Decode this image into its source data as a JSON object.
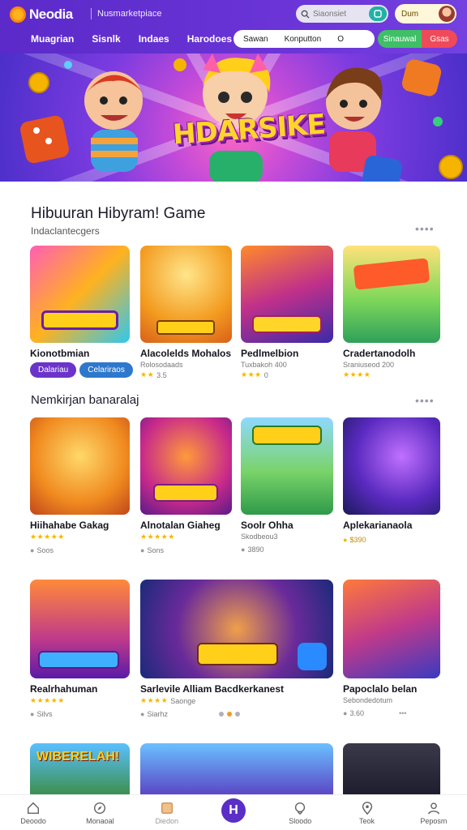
{
  "header": {
    "logo": "Neodia",
    "tagline": "Nusmarketpiace",
    "search_placeholder": "Siaonsiet",
    "user_label": "Dum",
    "nav": [
      "Muagrian",
      "Sisnlk",
      "Indaes",
      "Harodoes"
    ],
    "segments": [
      "Sawan",
      "Konputton",
      "O"
    ],
    "btn_green": "Sinauwal",
    "btn_red": "Gsas"
  },
  "hero": {
    "title": "HDARSIKE"
  },
  "section1": {
    "title": "Hibuuran Hibyram! Game",
    "subtitle": "Indaclantecgers",
    "cards": [
      {
        "name": "Kionotbmian",
        "tag1": "Dalariau",
        "tag2": "Celariraos"
      },
      {
        "name": "Alacolelds Mohalos",
        "meta": "Rolosodaads",
        "rating_text": "3.5"
      },
      {
        "name": "Pedlmelbion",
        "meta": "Tuxbakoh 400",
        "rating_text": "0"
      },
      {
        "name": "Cradertanodolh",
        "meta": "Sraniuseod 200",
        "rating_text": ""
      }
    ]
  },
  "section2": {
    "title": "Nemkirjan banaralaj",
    "row1": [
      {
        "name": "Hiihahabe Gakag",
        "meta": "Soos"
      },
      {
        "name": "Alnotalan Giaheg",
        "meta": "Sons"
      },
      {
        "name": "Soolr Ohha",
        "meta": "3890"
      },
      {
        "name": "Aplekarianaola",
        "meta": "$390"
      }
    ],
    "row2": [
      {
        "name": "Realrhahuman",
        "meta": "Silvs"
      },
      {
        "name": "Sarlevile Alliam Bacdkerkanest",
        "meta": "Siarhz",
        "sub": "Saonge"
      },
      {
        "name": "Papoclalo belan",
        "meta": "3.60"
      }
    ],
    "row3_titles": [
      "WIBERELAH!",
      "",
      ""
    ]
  },
  "tabbar": [
    "Deoodo",
    "Monaoal",
    "Diedon",
    "",
    "Sloodo",
    "Teok",
    "Peposm"
  ],
  "colors": {
    "accent": "#5b2ac9",
    "green": "#3fbf66",
    "red": "#ef4a5a",
    "star": "#f5b600"
  }
}
